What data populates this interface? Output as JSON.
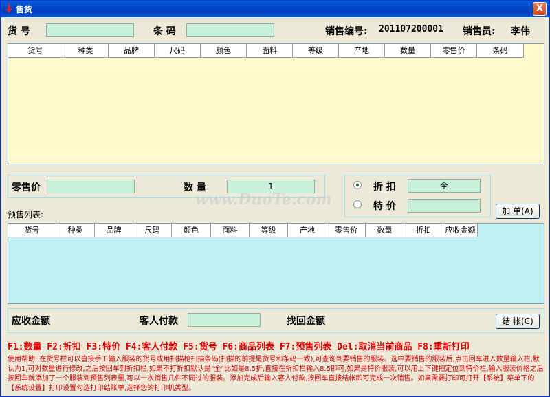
{
  "window": {
    "title": "售货",
    "close_label": "X"
  },
  "top": {
    "item_no_label": "货 号",
    "barcode_label": "条 码",
    "item_no_value": "",
    "barcode_value": "",
    "sale_no_label": "销售编号:",
    "sale_no_value": "201107200001",
    "salesperson_label": "销售员:",
    "salesperson_value": "李伟"
  },
  "goods_table": {
    "columns": [
      "货号",
      "种类",
      "品牌",
      "尺码",
      "颜色",
      "面料",
      "等级",
      "产地",
      "数量",
      "零售价",
      "条码"
    ],
    "rows": []
  },
  "price_panel": {
    "retail_price_label": "零售价",
    "retail_price_value": "",
    "qty_label": "数 量",
    "qty_value": "1"
  },
  "discount_panel": {
    "discount_label": "折 扣",
    "discount_value": "全",
    "special_label": "特 价",
    "special_value": "",
    "selected": "discount"
  },
  "add_button_label": "加 单(A)",
  "presale_label": "预售列表:",
  "presale_table": {
    "columns": [
      "货号",
      "种类",
      "品牌",
      "尺码",
      "颜色",
      "面料",
      "等级",
      "产地",
      "零售价",
      "数量",
      "折扣",
      "应收金额"
    ],
    "rows": []
  },
  "summary": {
    "receivable_label": "应收金额",
    "paid_label": "客人付款",
    "paid_value": "",
    "change_label": "找回金额",
    "checkout_label": "结 帐(C)"
  },
  "shortcuts": "F1:数量 F2:折扣 F3:特价 F4:客人付款 F5:货号 F6:商品列表 F7:预售列表 Del:取消当前商品 F8:重新打印",
  "help_text": "使用帮助: 在货号栏可以直接手工输入服装的货号或用扫描枪扫描条码(扫描的前提是货号和条码一致),可查询到要销售的服装。选中要销售的服装后,点击回车进入数量输入栏,默认为1,可对数量进行修改,之后按回车到折扣栏,如果不打折扣默认是\"全\"比如是8.5折,直接在折扣栏输入8.5即可,如果是特价服装,可以用上下键把定位到特价栏,输入服装价格之后按回车就添加了一个服装到预售列表里,可以一次销售几件不同过的服装。添加完成后输入客人付款,按回车直接结帐即可完成一次销售。如果需要打印可打开【系统】菜单下的【系统设置】打印设置勾选打印结账单,选择您的打印机类型。",
  "watermark": "www.DuoTe.com",
  "colors": {
    "title_bar": "#0047c9",
    "input_bg": "#c8f0d8",
    "goods_table_bg": "#fffacd",
    "presale_table_bg": "#c0f0f4",
    "help_text": "#e00000"
  }
}
